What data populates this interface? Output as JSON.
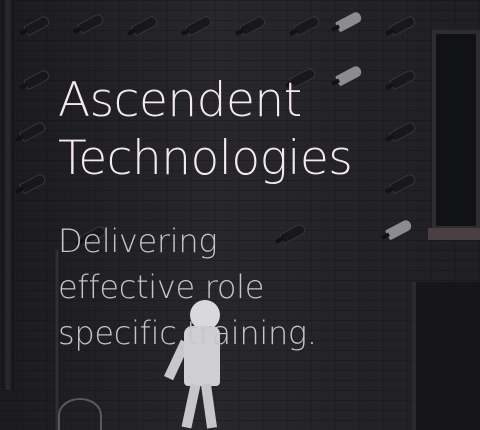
{
  "hero": {
    "title_lines": [
      "Ascendent",
      "Technologies"
    ],
    "subtitle_lines": [
      "Delivering",
      "effective role",
      "specific training."
    ]
  },
  "colors": {
    "title": "#f4e9ee",
    "subtitle": "#c9c2c6",
    "background": "#26252a"
  },
  "background_image": {
    "icons": [
      "security-camera-icon"
    ]
  }
}
